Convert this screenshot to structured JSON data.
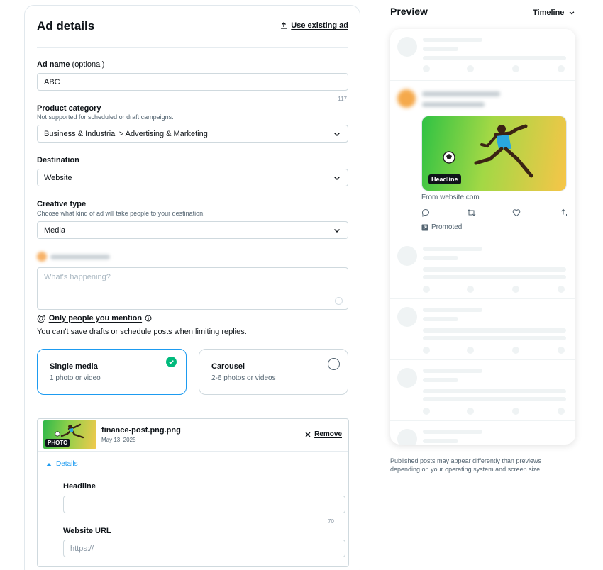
{
  "ad_details": {
    "title": "Ad details",
    "use_existing": "Use existing ad",
    "ad_name": {
      "label": "Ad name",
      "label_suffix": "(optional)",
      "value": "ABC",
      "counter": "117"
    },
    "product_category": {
      "label": "Product category",
      "sub": "Not supported for scheduled or draft campaigns.",
      "value": "Business & Industrial > Advertising & Marketing"
    },
    "destination": {
      "label": "Destination",
      "value": "Website"
    },
    "creative_type": {
      "label": "Creative type",
      "sub": "Choose what kind of ad will take people to your destination.",
      "value": "Media"
    },
    "compose_placeholder": "What's happening?",
    "reply_setting": "Only people you mention",
    "reply_note": "You can't save drafts or schedule posts when limiting replies.",
    "formats": [
      {
        "title": "Single media",
        "sub": "1 photo or video",
        "selected": true
      },
      {
        "title": "Carousel",
        "sub": "2-6 photos or videos",
        "selected": false
      }
    ],
    "media": {
      "badge": "PHOTO",
      "file_name": "finance-post.png.png",
      "date": "May 13, 2025",
      "remove": "Remove",
      "details": "Details",
      "headline_label": "Headline",
      "headline_counter": "70",
      "url_label": "Website URL",
      "url_placeholder": "https://"
    }
  },
  "preview": {
    "title": "Preview",
    "view": "Timeline",
    "headline_badge": "Headline",
    "from": "From website.com",
    "promoted": "Promoted",
    "footer": "Published posts may appear differently than previews depending on your operating system and screen size."
  },
  "colors": {
    "accent": "#1d9bf0",
    "check": "#00ba7c",
    "border": "#cfd9de"
  }
}
